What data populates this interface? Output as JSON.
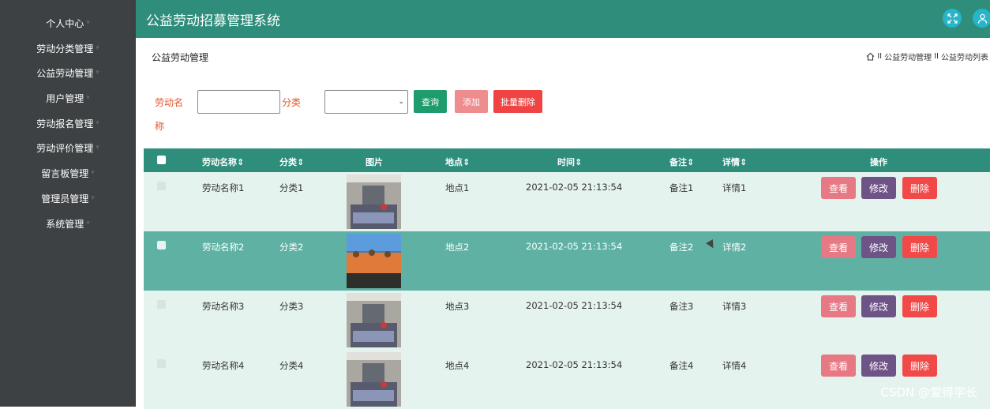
{
  "app": {
    "title": "公益劳动招募管理系统"
  },
  "sidebar": {
    "items": [
      {
        "label": "个人中心"
      },
      {
        "label": "劳动分类管理"
      },
      {
        "label": "公益劳动管理"
      },
      {
        "label": "用户管理"
      },
      {
        "label": "劳动报名管理"
      },
      {
        "label": "劳动评价管理"
      },
      {
        "label": "留言板管理"
      },
      {
        "label": "管理员管理"
      },
      {
        "label": "系统管理"
      }
    ]
  },
  "page": {
    "title": "公益劳动管理"
  },
  "breadcrumb": {
    "separator": "II",
    "items": [
      "公益劳动管理",
      "公益劳动列表"
    ]
  },
  "search": {
    "name_label_line1": "劳动名",
    "name_label_line2": "称",
    "name_value": "",
    "category_label": "分类",
    "category_value": "",
    "query_label": "查询",
    "add_label": "添加",
    "batch_delete_label": "批量删除"
  },
  "table": {
    "headers": [
      "劳动名称",
      "分类",
      "图片",
      "地点",
      "时间",
      "备注",
      "详情",
      "操作"
    ],
    "sort_glyph": "⇕",
    "rows": [
      {
        "name": "劳动名称1",
        "category": "分类1",
        "location": "地点1",
        "time": "2021-02-05 21:13:54",
        "note": "备注1",
        "detail": "详情1"
      },
      {
        "name": "劳动名称2",
        "category": "分类2",
        "location": "地点2",
        "time": "2021-02-05 21:13:54",
        "note": "备注2",
        "detail": "详情2"
      },
      {
        "name": "劳动名称3",
        "category": "分类3",
        "location": "地点3",
        "time": "2021-02-05 21:13:54",
        "note": "备注3",
        "detail": "详情3"
      },
      {
        "name": "劳动名称4",
        "category": "分类4",
        "location": "地点4",
        "time": "2021-02-05 21:13:54",
        "note": "备注4",
        "detail": "详情4"
      }
    ],
    "actions": {
      "view": "查看",
      "edit": "修改",
      "delete": "删除"
    }
  },
  "watermark": "CSDN @爱得学长",
  "colors": {
    "sidebar_bg": "#3d4143",
    "header_bg": "#2e8d7b",
    "row_bg": "#e5f3ef",
    "row_hover": "#5fb1a3",
    "view_btn": "#e67983",
    "edit_btn": "#6e5387",
    "delete_btn": "#f14848",
    "query_btn": "#1e9c6c",
    "add_btn": "#ee8c90",
    "batch_delete_btn": "#f04444",
    "icon_btn": "#26b5c9"
  },
  "icons": {
    "fullscreen": "fullscreen-icon",
    "user": "user-icon",
    "home": "home-icon",
    "dropdown": "chevron-down-icon",
    "sort": "sort-icon"
  }
}
